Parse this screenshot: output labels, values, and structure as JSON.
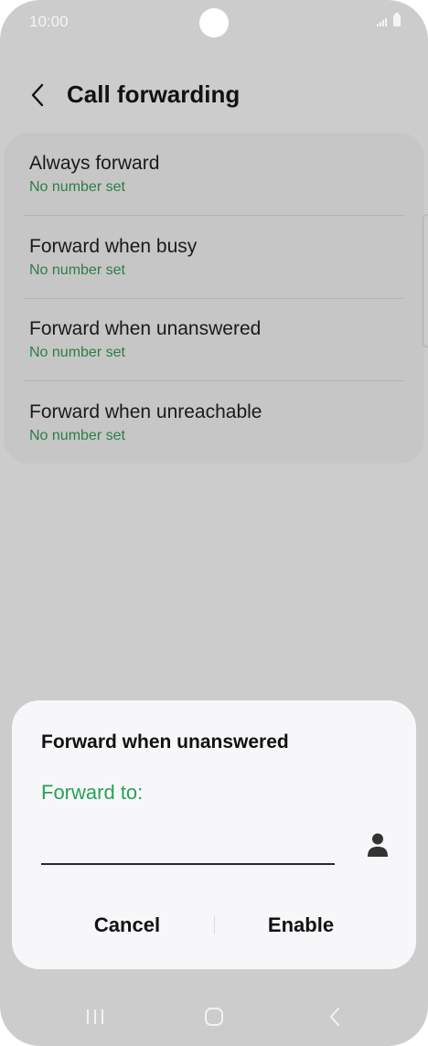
{
  "status_bar": {
    "time": "10:00"
  },
  "header": {
    "title": "Call forwarding"
  },
  "list": {
    "items": [
      {
        "label": "Always forward",
        "sub": "No number set"
      },
      {
        "label": "Forward when busy",
        "sub": "No number set"
      },
      {
        "label": "Forward when unanswered",
        "sub": "No number set"
      },
      {
        "label": "Forward when unreachable",
        "sub": "No number set"
      }
    ]
  },
  "dialog": {
    "title": "Forward when unanswered",
    "field_label": "Forward to:",
    "input_value": "",
    "cancel_label": "Cancel",
    "enable_label": "Enable"
  },
  "icons": {
    "back": "back-arrow-icon",
    "contacts": "contact-person-icon",
    "signal": "signal-icon",
    "battery": "battery-icon",
    "nav_recents": "recents-icon",
    "nav_home": "home-icon",
    "nav_back": "nav-back-icon"
  },
  "colors": {
    "background": "#cccccc",
    "card": "#c6c6c6",
    "dialog": "#f7f7f9",
    "accent_green": "#25a25a",
    "subtext_green": "#2e7d46"
  }
}
